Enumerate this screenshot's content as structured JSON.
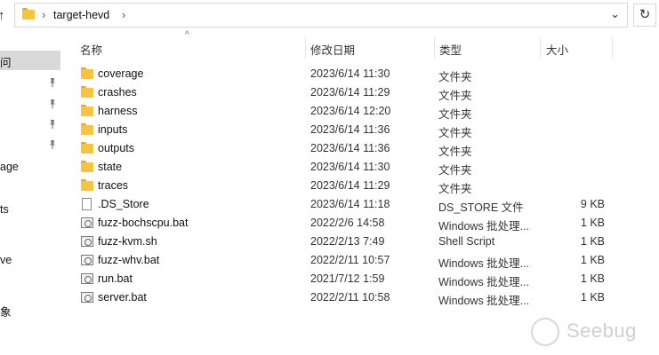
{
  "address_bar": {
    "path_segment": "target-hevd",
    "separator": "›",
    "dropdown_glyph": "⌄",
    "up_glyph": "↑",
    "refresh_glyph": "↻"
  },
  "nav_pane": {
    "items": [
      {
        "label": "问"
      },
      {
        "label": "age"
      },
      {
        "label": "ts"
      },
      {
        "label": "ve"
      },
      {
        "label": "象"
      }
    ]
  },
  "columns": {
    "name": "名称",
    "date": "修改日期",
    "type": "类型",
    "size": "大小",
    "sort_glyph": "^"
  },
  "files": [
    {
      "name": "coverage",
      "date": "2023/6/14 11:30",
      "type": "文件夹",
      "size": "",
      "kind": "folder"
    },
    {
      "name": "crashes",
      "date": "2023/6/14 11:29",
      "type": "文件夹",
      "size": "",
      "kind": "folder"
    },
    {
      "name": "harness",
      "date": "2023/6/14 12:20",
      "type": "文件夹",
      "size": "",
      "kind": "folder"
    },
    {
      "name": "inputs",
      "date": "2023/6/14 11:36",
      "type": "文件夹",
      "size": "",
      "kind": "folder"
    },
    {
      "name": "outputs",
      "date": "2023/6/14 11:36",
      "type": "文件夹",
      "size": "",
      "kind": "folder"
    },
    {
      "name": "state",
      "date": "2023/6/14 11:30",
      "type": "文件夹",
      "size": "",
      "kind": "folder"
    },
    {
      "name": "traces",
      "date": "2023/6/14 11:29",
      "type": "文件夹",
      "size": "",
      "kind": "folder"
    },
    {
      "name": ".DS_Store",
      "date": "2023/6/14 11:18",
      "type": "DS_STORE 文件",
      "size": "9 KB",
      "kind": "file"
    },
    {
      "name": "fuzz-bochscpu.bat",
      "date": "2022/2/6 14:58",
      "type": "Windows 批处理...",
      "size": "1 KB",
      "kind": "script"
    },
    {
      "name": "fuzz-kvm.sh",
      "date": "2022/2/13 7:49",
      "type": "Shell Script",
      "size": "1 KB",
      "kind": "script"
    },
    {
      "name": "fuzz-whv.bat",
      "date": "2022/2/11 10:57",
      "type": "Windows 批处理...",
      "size": "1 KB",
      "kind": "script"
    },
    {
      "name": "run.bat",
      "date": "2021/7/12 1:59",
      "type": "Windows 批处理...",
      "size": "1 KB",
      "kind": "script"
    },
    {
      "name": "server.bat",
      "date": "2022/2/11 10:58",
      "type": "Windows 批处理...",
      "size": "1 KB",
      "kind": "script"
    }
  ],
  "watermark": {
    "text": "Seebug"
  },
  "colors": {
    "folder": "#f6c343",
    "selection": "#d9d9d9"
  }
}
